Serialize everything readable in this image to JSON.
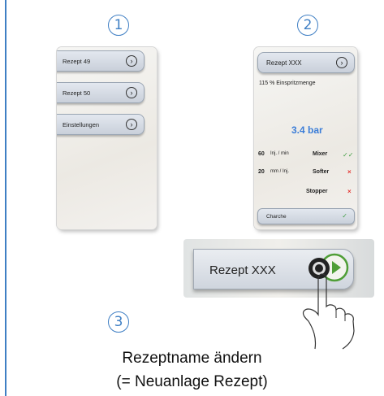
{
  "steps": [
    "1",
    "2",
    "3"
  ],
  "screen1": {
    "items": [
      {
        "label": "Rezept 49",
        "chevron": "›"
      },
      {
        "label": "Rezept 50",
        "chevron": "›"
      },
      {
        "label": "Einstellungen",
        "chevron": "›"
      }
    ]
  },
  "screen2": {
    "header": "Rezept XXX",
    "chevron": "›",
    "injection": "115 % Einspritzmenge",
    "pressure": "3.4 bar",
    "rows": [
      {
        "num": "60",
        "unit": "Inj. / min",
        "name": "Mixer",
        "status": "✓✓"
      },
      {
        "num": "20",
        "unit": "mm / Inj.",
        "name": "Softer",
        "status": "×"
      },
      {
        "num": "",
        "unit": "",
        "name": "Stopper",
        "status": "×"
      }
    ],
    "footer": "Charche",
    "footer_status": "✓"
  },
  "zoom": {
    "label": "Rezept XXX",
    "icon": "play-button-icon"
  },
  "caption": {
    "line1": "Rezeptname ändern",
    "line2": "(= Neuanlage Rezept)"
  },
  "colors": {
    "accent": "#3f7fc4",
    "pressure": "#3b7dd8",
    "ok": "#43a047",
    "error": "#e53935"
  }
}
